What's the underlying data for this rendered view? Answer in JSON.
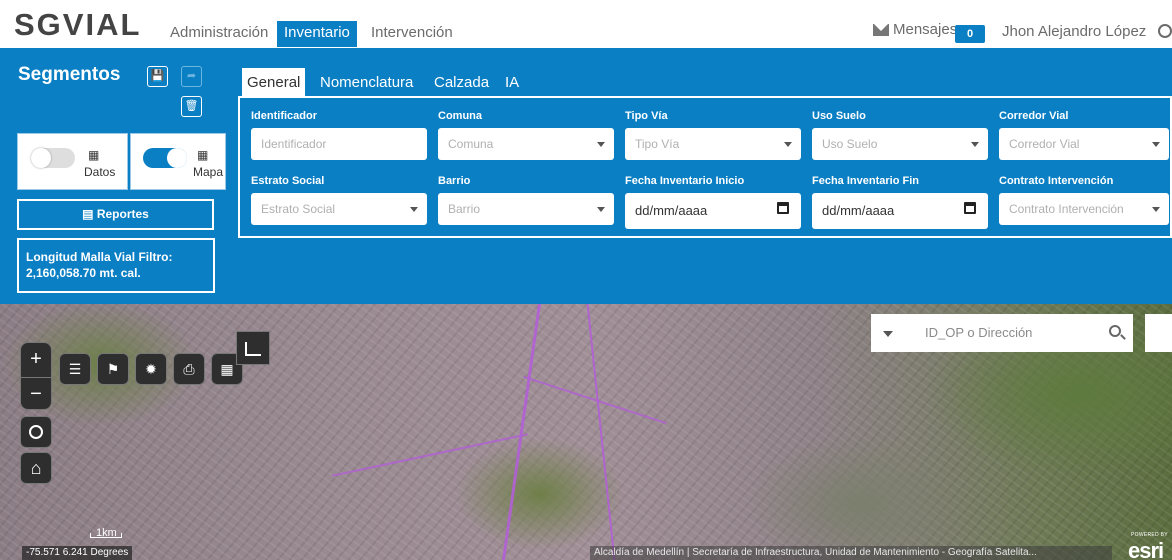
{
  "header": {
    "logo": "SGVIAL",
    "nav": [
      "Administración",
      "Inventario",
      "Intervención"
    ],
    "active_nav": "Inventario",
    "messages_label": "Mensajes",
    "messages_count": "0",
    "user_name": "Jhon Alejandro López",
    "icons": [
      "envelope-icon",
      "user-circle-icon"
    ]
  },
  "sidebar": {
    "title": "Segmentos",
    "icons": [
      "save-icon",
      "redo-icon",
      "trash-icon"
    ],
    "toggle_datos": {
      "label": "Datos",
      "icon": "table-icon",
      "on": false
    },
    "toggle_mapa": {
      "label": "Mapa",
      "icon": "map-icon",
      "on": true
    },
    "reportes_label": "Reportes",
    "longitud_label": "Longitud Malla Vial Filtro:",
    "longitud_value": "2,160,058.70 mt. cal."
  },
  "tabs": [
    "General",
    "Nomenclatura",
    "Calzada",
    "IA"
  ],
  "active_tab": "General",
  "filters": {
    "identificador": {
      "label": "Identificador",
      "placeholder": "Identificador"
    },
    "comuna": {
      "label": "Comuna",
      "placeholder": "Comuna"
    },
    "tipo_via": {
      "label": "Tipo Vía",
      "placeholder": "Tipo Vía"
    },
    "uso_suelo": {
      "label": "Uso Suelo",
      "placeholder": "Uso Suelo"
    },
    "corredor_vial": {
      "label": "Corredor Vial",
      "placeholder": "Corredor Vial"
    },
    "estrato_social": {
      "label": "Estrato Social",
      "placeholder": "Estrato Social"
    },
    "barrio": {
      "label": "Barrio",
      "placeholder": "Barrio"
    },
    "fecha_inicio": {
      "label": "Fecha Inventario Inicio",
      "value": "dd/mm/aaaa"
    },
    "fecha_fin": {
      "label": "Fecha Inventario Fin",
      "value": "dd/mm/aaaa"
    },
    "contrato": {
      "label": "Contrato Intervención",
      "placeholder": "Contrato Intervención"
    }
  },
  "map": {
    "search_placeholder": "ID_OP o Dirección",
    "zoom_in": "+",
    "zoom_out": "−",
    "scale_label": "1km",
    "coordinates": "-75.571 6.241 Degrees",
    "attribution": "Alcaldía de Medellín | Secretaría de Infraestructura, Unidad de Mantenimiento - Geografía Satelita...",
    "powered_by": "POWERED BY",
    "esri_logo": "esri",
    "tools": [
      "layers-icon",
      "legend-icon",
      "basemap-icon",
      "print-icon",
      "grid-icon",
      "chart-icon"
    ],
    "route_color": "#b25fd6"
  },
  "colors": {
    "brand_blue": "#0a7fc4"
  }
}
